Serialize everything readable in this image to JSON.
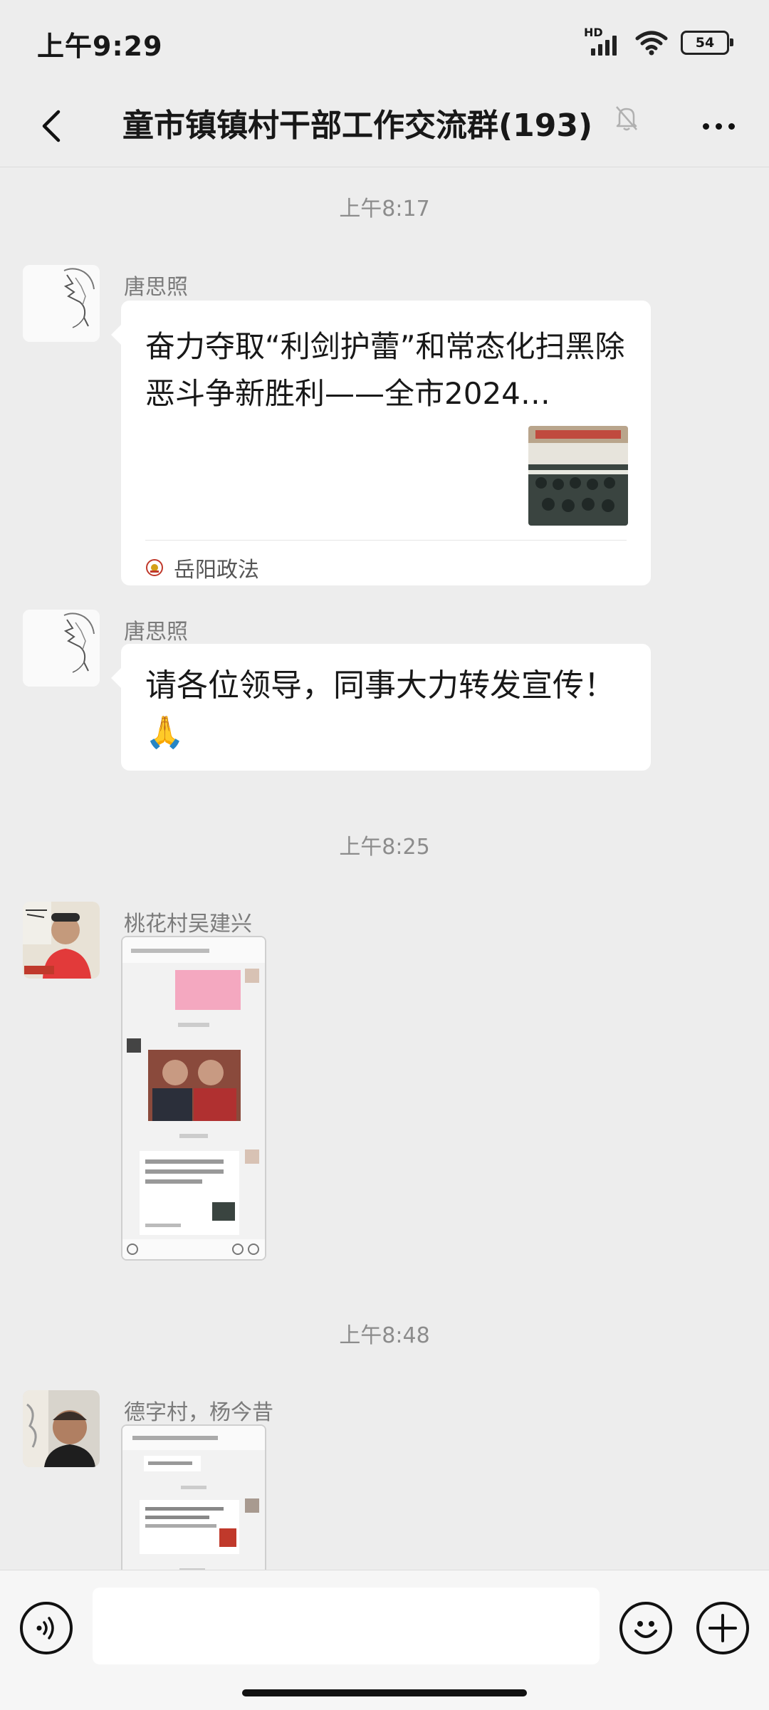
{
  "status_bar": {
    "time": "上午9:29",
    "network": "HD",
    "battery": "54"
  },
  "header": {
    "title": "童市镇镇村干部工作交流群(193)"
  },
  "messages": [
    {
      "timestamp": "上午8:17"
    },
    {
      "sender": "唐思照",
      "type": "link",
      "link_title": "奋力夺取“利剑护蕾”和常态化扫黑除恶斗争新胜利——全市2024…",
      "link_source": "岳阳政法"
    },
    {
      "sender": "唐思照",
      "type": "text",
      "text": "请各位领导，同事大力转发宣传！",
      "emoji": "🙏"
    },
    {
      "timestamp": "上午8:25"
    },
    {
      "sender": "桃花村吴建兴",
      "type": "image"
    },
    {
      "timestamp": "上午8:48"
    },
    {
      "sender": "德字村，杨今昔",
      "type": "image"
    }
  ],
  "input_bar": {
    "voice_icon": "voice-icon",
    "emoji_icon": "smile-icon",
    "plus_icon": "plus-icon"
  },
  "colors": {
    "background": "#ededed",
    "bubble": "#ffffff",
    "timestamp": "#8c8c8c",
    "sender": "#7b7b7b"
  }
}
